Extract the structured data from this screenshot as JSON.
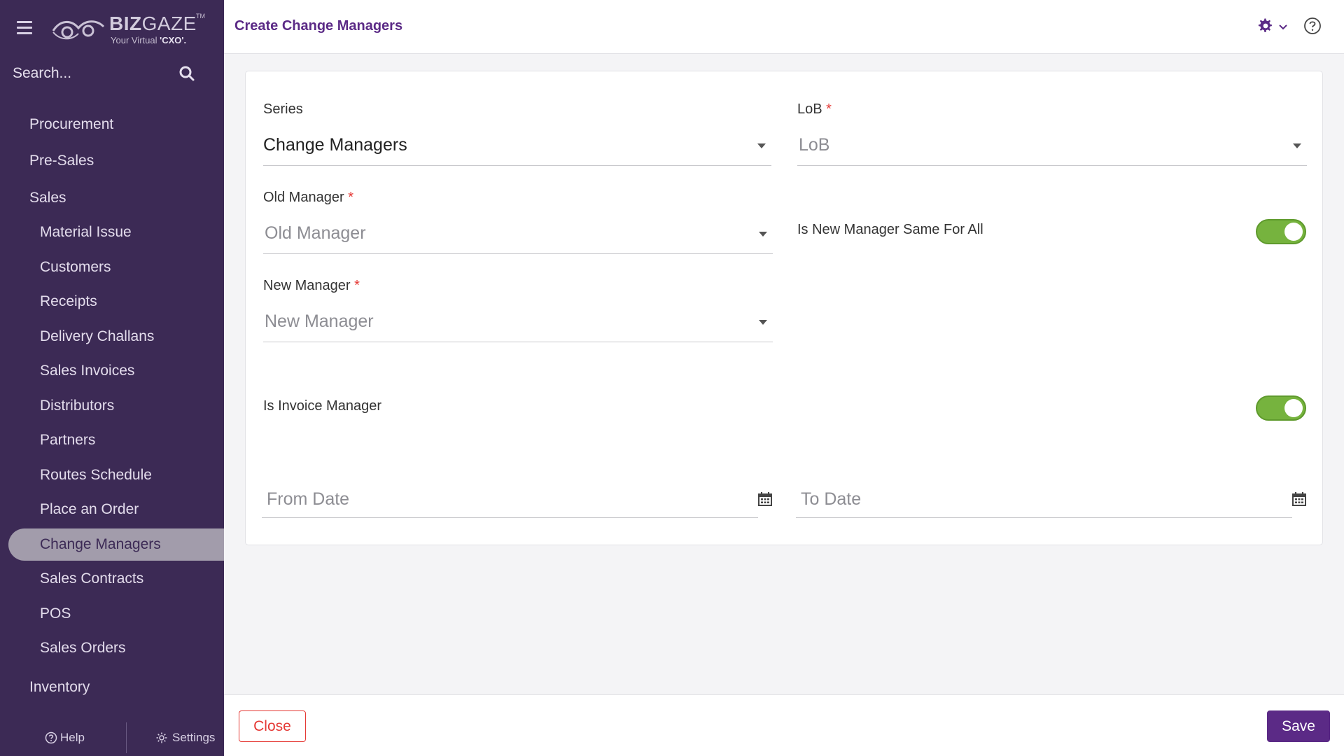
{
  "sidebar": {
    "logo": {
      "name_bold": "BIZ",
      "name_light": "GAZE",
      "trademark": "TM",
      "tagline_prefix": "Your Virtual ",
      "tagline_bold": "'CXO'."
    },
    "search": {
      "placeholder": "Search..."
    },
    "menu": [
      {
        "label": "Procurement"
      },
      {
        "label": "Pre-Sales"
      },
      {
        "label": "Sales"
      },
      {
        "label": "Material Issue"
      },
      {
        "label": "Customers"
      },
      {
        "label": "Receipts"
      },
      {
        "label": "Delivery Challans"
      },
      {
        "label": "Sales Invoices"
      },
      {
        "label": "Distributors"
      },
      {
        "label": "Partners"
      },
      {
        "label": "Routes Schedule"
      },
      {
        "label": "Place an Order"
      },
      {
        "label": "Change Managers"
      },
      {
        "label": "Sales Contracts"
      },
      {
        "label": "POS"
      },
      {
        "label": "Sales Orders"
      },
      {
        "label": "Inventory"
      }
    ],
    "bottom": {
      "help": "Help",
      "settings": "Settings"
    }
  },
  "header": {
    "title": "Create Change Managers"
  },
  "form": {
    "series": {
      "label": "Series",
      "value": "Change Managers"
    },
    "lob": {
      "label": "LoB",
      "required": "*",
      "placeholder": "LoB"
    },
    "old_manager": {
      "label": "Old Manager",
      "required": "*",
      "placeholder": "Old Manager"
    },
    "same_for_all": {
      "label": "Is New Manager Same For All",
      "on": true
    },
    "new_manager": {
      "label": "New Manager",
      "required": "*",
      "placeholder": "New Manager"
    },
    "invoice_manager": {
      "label": "Is Invoice Manager",
      "on": true
    },
    "from_date": {
      "placeholder": "From Date"
    },
    "to_date": {
      "placeholder": "To Date"
    }
  },
  "footer": {
    "close": "Close",
    "save": "Save"
  },
  "colors": {
    "sidebar_bg": "#3c2a55",
    "brand": "#5b2a86",
    "toggle_on": "#76b33e",
    "danger": "#e53935"
  }
}
